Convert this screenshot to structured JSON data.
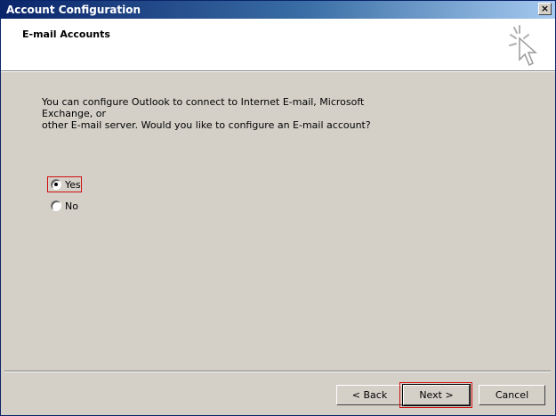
{
  "window": {
    "title": "Account Configuration",
    "close_label": "×"
  },
  "header": {
    "title": "E-mail Accounts",
    "icon": "wizard-cursor-icon"
  },
  "content": {
    "prompt_line1": "You can configure Outlook to connect to Internet E-mail, Microsoft Exchange, or",
    "prompt_line2": "other E-mail server. Would you like to configure an E-mail account?",
    "options": [
      {
        "label": "Yes",
        "selected": true
      },
      {
        "label": "No",
        "selected": false
      }
    ]
  },
  "buttons": {
    "back": "< Back",
    "next": "Next >",
    "cancel": "Cancel"
  },
  "colors": {
    "title_gradient_start": "#0a246a",
    "title_gradient_end": "#a6caf0",
    "highlight": "#d01010",
    "dialog_bg": "#d4d0c8"
  }
}
